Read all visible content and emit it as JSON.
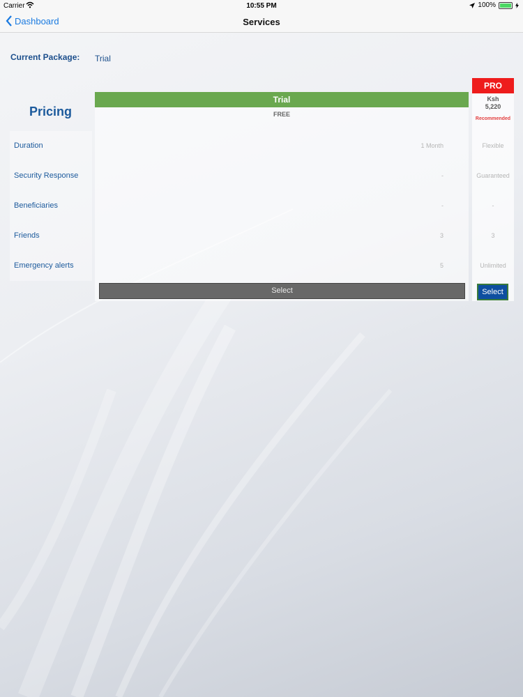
{
  "status_bar": {
    "carrier": "Carrier",
    "time": "10:55 PM",
    "battery": "100%"
  },
  "nav": {
    "back_label": "Dashboard",
    "title": "Services"
  },
  "current_package": {
    "label": "Current Package:",
    "value": "Trial"
  },
  "pricing": {
    "title": "Pricing",
    "rows": [
      "Duration",
      "Security Response",
      "Beneficiaries",
      "Friends",
      "Emergency alerts"
    ]
  },
  "plans": {
    "trial": {
      "name": "Trial",
      "price": "FREE",
      "values": [
        "1 Month",
        "-",
        "-",
        "3",
        "5"
      ],
      "select_label": "Select",
      "color": "#6aa84f"
    },
    "pro": {
      "name": "PRO",
      "currency": "Ksh",
      "price": "5,220",
      "badge": "Recommended",
      "values": [
        "Flexible",
        "Guaranteed",
        "-",
        "3",
        "Unlimited"
      ],
      "select_label": "Select",
      "color": "#ee1c1c"
    }
  }
}
